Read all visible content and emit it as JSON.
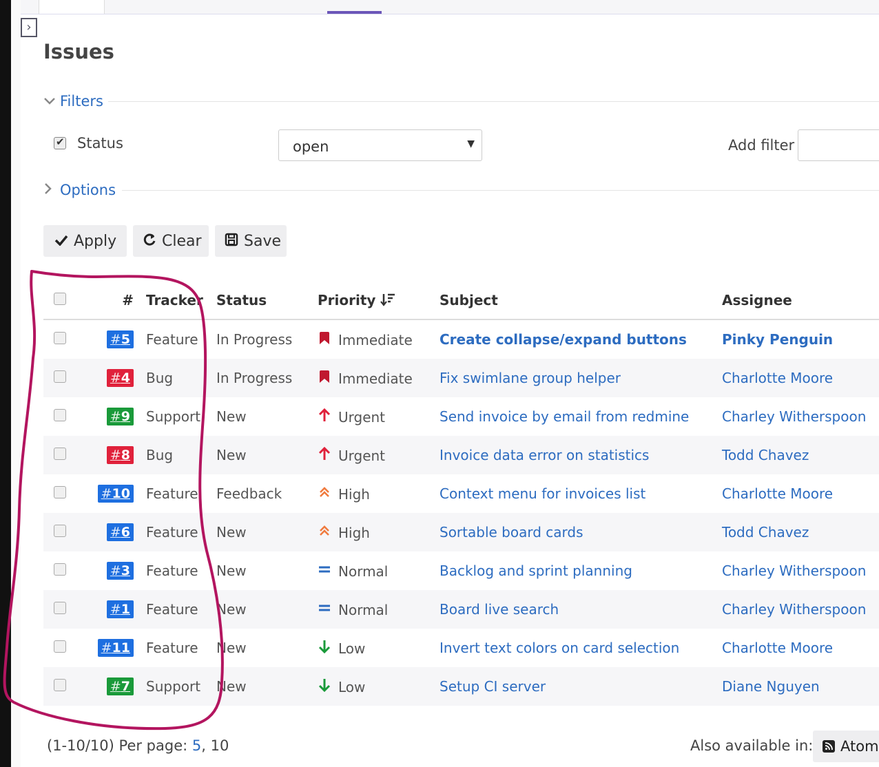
{
  "page": {
    "title": "Issues"
  },
  "filters": {
    "legend": "Filters",
    "status_label": "Status",
    "status_value": "open",
    "add_filter_label": "Add filter"
  },
  "options": {
    "legend": "Options"
  },
  "buttons": {
    "apply": "Apply",
    "clear": "Clear",
    "save": "Save"
  },
  "table": {
    "headers": {
      "num": "#",
      "tracker": "Tracker",
      "status": "Status",
      "priority": "Priority",
      "subject": "Subject",
      "assignee": "Assignee"
    },
    "rows": [
      {
        "id": "5",
        "tracker": "Feature",
        "status": "In Progress",
        "priority": "Immediate",
        "subject": "Create collapse/expand buttons",
        "assignee": "Pinky Penguin"
      },
      {
        "id": "4",
        "tracker": "Bug",
        "status": "In Progress",
        "priority": "Immediate",
        "subject": "Fix swimlane group helper",
        "assignee": "Charlotte Moore"
      },
      {
        "id": "9",
        "tracker": "Support",
        "status": "New",
        "priority": "Urgent",
        "subject": "Send invoice by email from redmine",
        "assignee": "Charley Witherspoon"
      },
      {
        "id": "8",
        "tracker": "Bug",
        "status": "New",
        "priority": "Urgent",
        "subject": "Invoice data error on statistics",
        "assignee": "Todd Chavez"
      },
      {
        "id": "10",
        "tracker": "Feature",
        "status": "Feedback",
        "priority": "High",
        "subject": "Context menu for invoices list",
        "assignee": "Charlotte Moore"
      },
      {
        "id": "6",
        "tracker": "Feature",
        "status": "New",
        "priority": "High",
        "subject": "Sortable board cards",
        "assignee": "Todd Chavez"
      },
      {
        "id": "3",
        "tracker": "Feature",
        "status": "New",
        "priority": "Normal",
        "subject": "Backlog and sprint planning",
        "assignee": "Charley Witherspoon"
      },
      {
        "id": "1",
        "tracker": "Feature",
        "status": "New",
        "priority": "Normal",
        "subject": "Board live search",
        "assignee": "Charley Witherspoon"
      },
      {
        "id": "11",
        "tracker": "Feature",
        "status": "New",
        "priority": "Low",
        "subject": "Invert text colors on card selection",
        "assignee": "Charlotte Moore"
      },
      {
        "id": "7",
        "tracker": "Support",
        "status": "New",
        "priority": "Low",
        "subject": "Setup CI server",
        "assignee": "Diane Nguyen"
      }
    ]
  },
  "tracker_colors": {
    "Feature": "#1e6fe0",
    "Bug": "#e0213b",
    "Support": "#1a9a3a"
  },
  "priority_icons": {
    "Immediate": {
      "icon": "bookmark-icon",
      "color": "#c0182f"
    },
    "Urgent": {
      "icon": "arrow-up-icon",
      "color": "#e0213b"
    },
    "High": {
      "icon": "double-chevron-up-icon",
      "color": "#f07b3f"
    },
    "Normal": {
      "icon": "equals-icon",
      "color": "#2d6cc0"
    },
    "Low": {
      "icon": "arrow-down-icon",
      "color": "#1a9a3a"
    }
  },
  "footer": {
    "range": "(1-10/10)",
    "per_page_label": "Per page:",
    "per_page_5": "5",
    "per_page_sep": ",",
    "per_page_10": "10",
    "also_available": "Also available in:",
    "atom": "Atom"
  },
  "annotation_color": "#b3155f"
}
